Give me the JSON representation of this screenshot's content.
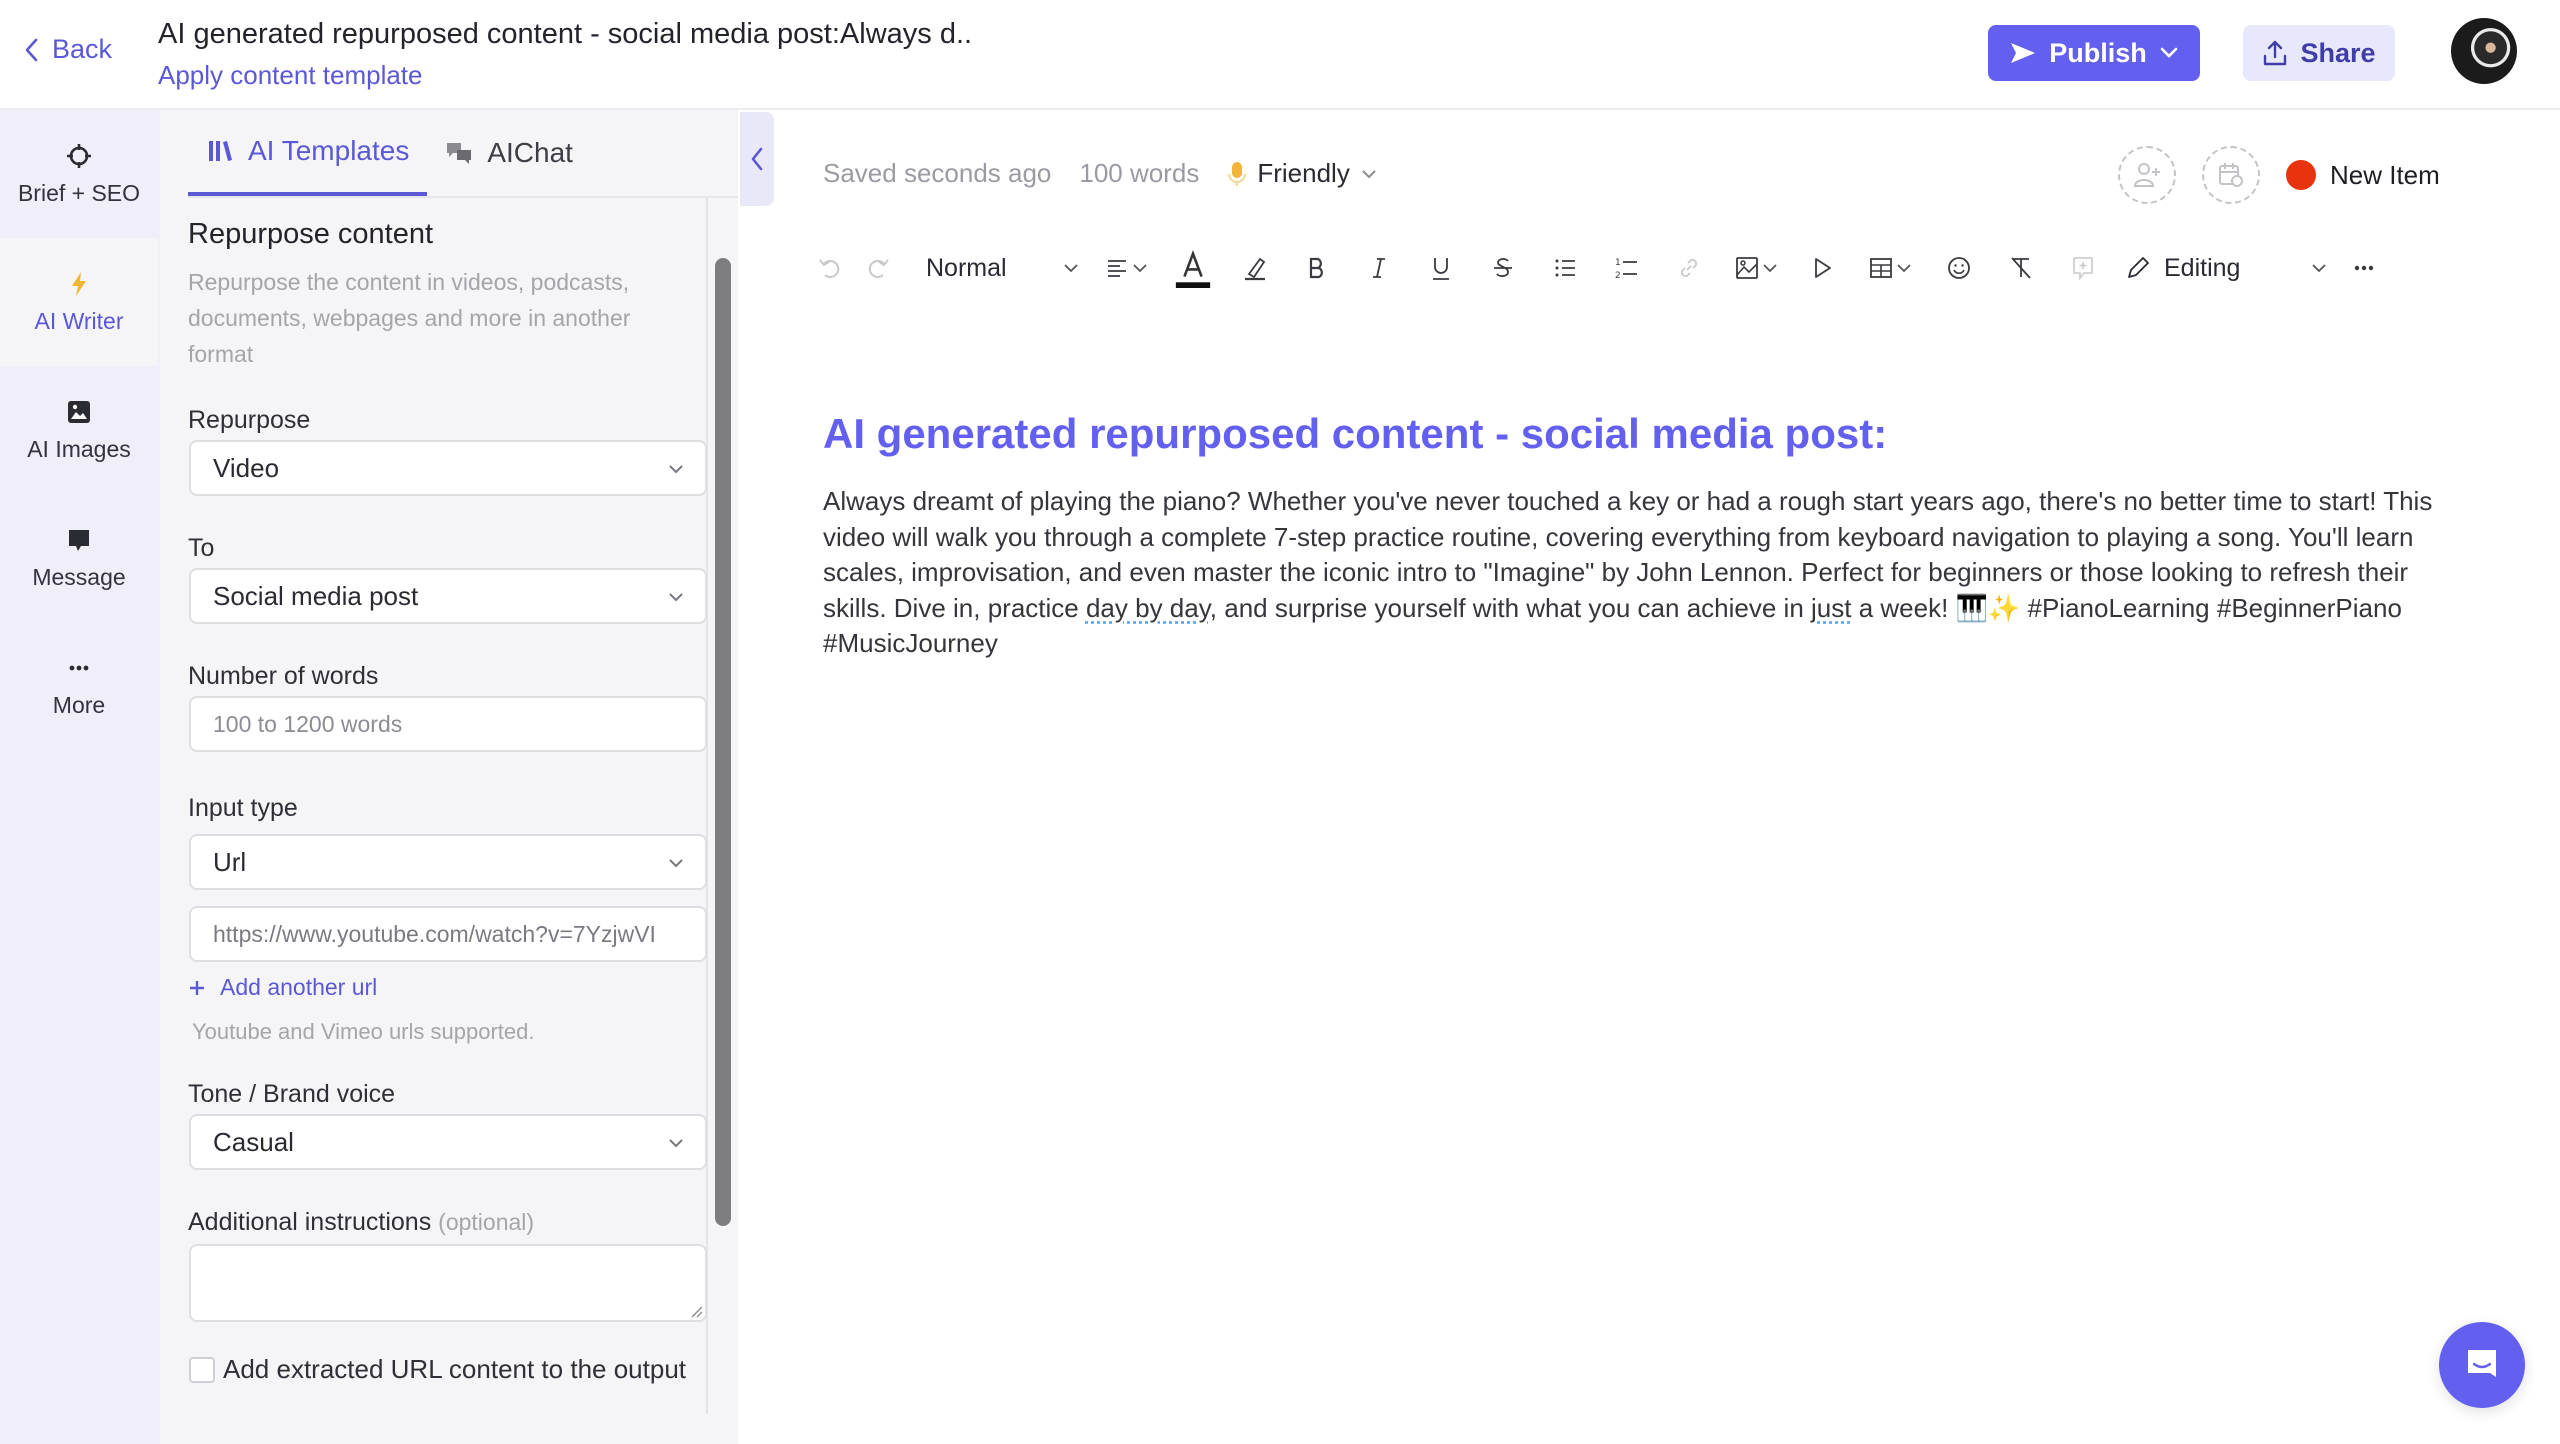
{
  "header": {
    "back_label": "Back",
    "title": "AI generated repurposed content - social media post:Always d..",
    "apply_template_label": "Apply content template",
    "publish_label": "Publish",
    "share_label": "Share"
  },
  "rail": {
    "items": [
      {
        "label": "Brief + SEO",
        "icon": "crosshair-icon"
      },
      {
        "label": "AI Writer",
        "icon": "lightning-icon",
        "active": true
      },
      {
        "label": "AI Images",
        "icon": "image-icon"
      },
      {
        "label": "Message",
        "icon": "message-icon"
      },
      {
        "label": "More",
        "icon": "more-icon"
      }
    ]
  },
  "panel": {
    "tabs": [
      {
        "label": "AI Templates",
        "icon": "library-icon",
        "active": true
      },
      {
        "label": "AIChat",
        "icon": "chat-bubbles-icon"
      }
    ],
    "section_title": "Repurpose content",
    "section_desc": "Repurpose the content in videos, podcasts, documents, webpages and more in another format",
    "fields": {
      "repurpose": {
        "label": "Repurpose",
        "value": "Video"
      },
      "to": {
        "label": "To",
        "value": "Social media post"
      },
      "word_count": {
        "label": "Number of words",
        "placeholder": "100 to 1200 words"
      },
      "input_type": {
        "label": "Input type",
        "value": "Url"
      },
      "url": {
        "value": "https://www.youtube.com/watch?v=7YzjwVI"
      },
      "add_url_label": "Add another url",
      "url_hint": "Youtube and Vimeo urls supported.",
      "tone": {
        "label": "Tone / Brand voice",
        "value": "Casual"
      },
      "instructions": {
        "label": "Additional instructions",
        "optional": "(optional)",
        "value": ""
      },
      "extract_checkbox": {
        "label": "Add extracted URL content to the output",
        "checked": false
      }
    }
  },
  "editor": {
    "status_saved": "Saved seconds ago",
    "word_count": "100 words",
    "tone": "Friendly",
    "status_label": "New Item",
    "status_color": "#e8330f",
    "toolbar": {
      "block_style": "Normal",
      "mode": "Editing"
    },
    "content_title": "AI generated repurposed content - social media post:",
    "content_body_parts": {
      "p1": "Always dreamt of playing the piano? Whether you've never touched a key or had a rough start years ago, there's no better time to start! This video will walk you through a complete 7-step practice routine, covering everything from keyboard navigation to playing a song. You'll learn scales, improvisation, and even master the iconic intro to \"Imagine\" by John Lennon. Perfect for beginners or those looking to refresh their skills. Dive in, practice ",
      "u1": "day by day",
      "p2": ", and surprise yourself with what you can achieve in ",
      "u2": "just",
      "p3": " a week! 🎹✨ #PianoLearning #BeginnerPiano #MusicJourney"
    }
  },
  "colors": {
    "accent": "#6360ef",
    "accent_light": "#e8e8fc",
    "rail_bg": "#efeef9",
    "panel_bg": "#f5f5f7"
  }
}
